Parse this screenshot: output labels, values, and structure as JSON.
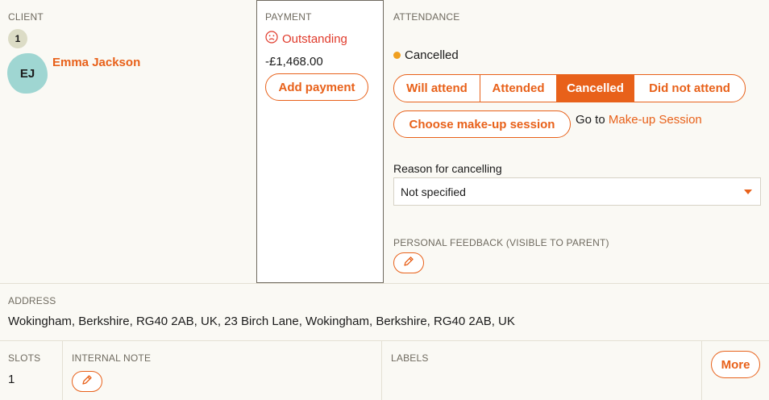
{
  "client": {
    "section_label": "CLIENT",
    "count": "1",
    "initials": "EJ",
    "name": "Emma Jackson"
  },
  "payment": {
    "section_label": "PAYMENT",
    "status": "Outstanding",
    "status_icon": "sad-face-icon",
    "amount": "-£1,468.00",
    "add_label": "Add payment"
  },
  "attendance": {
    "section_label": "ATTENDANCE",
    "current_status": "Cancelled",
    "status_color": "#f0a020",
    "options": [
      "Will attend",
      "Attended",
      "Cancelled",
      "Did not attend"
    ],
    "selected": "Cancelled",
    "makeup_label": "Choose make-up session",
    "goto_text": "Go to",
    "goto_link": "Make-up Session",
    "reason_label": "Reason for cancelling",
    "reason_value": "Not specified",
    "feedback_label": "PERSONAL FEEDBACK (VISIBLE TO PARENT)"
  },
  "address": {
    "section_label": "ADDRESS",
    "value": "Wokingham, Berkshire, RG40 2AB, UK, 23 Birch Lane, Wokingham, Berkshire, RG40 2AB, UK"
  },
  "slots": {
    "section_label": "SLOTS",
    "value": "1"
  },
  "internal_note": {
    "section_label": "INTERNAL NOTE"
  },
  "labels": {
    "section_label": "LABELS"
  },
  "more_label": "More",
  "colors": {
    "accent": "#e8611a",
    "outstanding": "#e03a2b",
    "avatar": "#9fd6d2",
    "background": "#faf9f4"
  }
}
